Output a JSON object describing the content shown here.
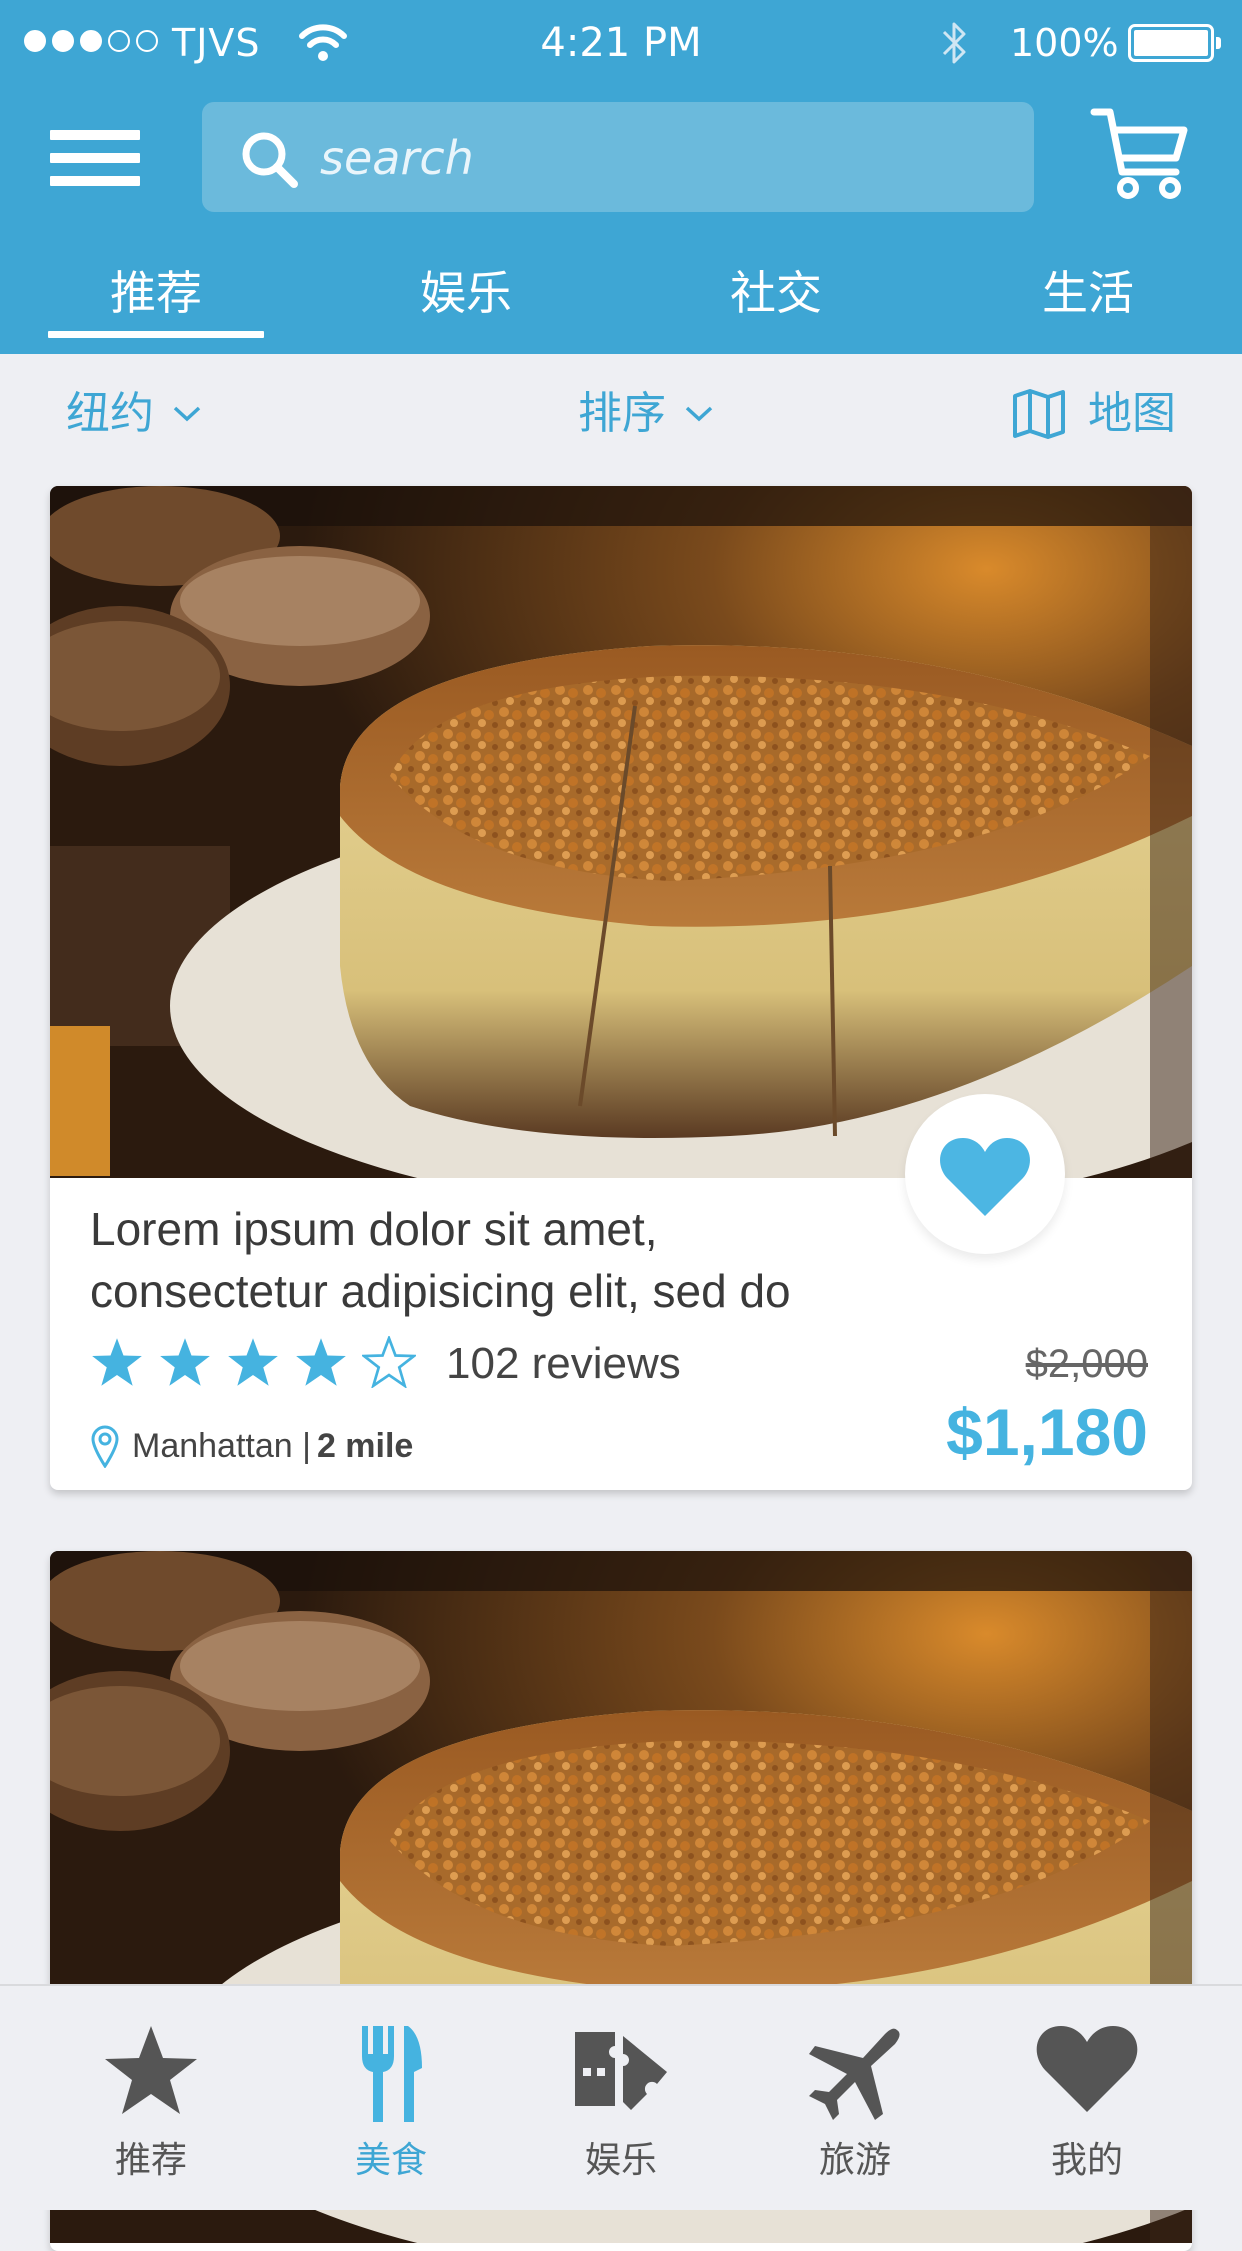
{
  "status_bar": {
    "carrier": "TJVS",
    "time": "4:21 PM",
    "battery": "100%",
    "signal_bars": 3
  },
  "header": {
    "search_placeholder": "search",
    "tabs": [
      {
        "label": "推荐",
        "active": true
      },
      {
        "label": "娱乐",
        "active": false
      },
      {
        "label": "社交",
        "active": false
      },
      {
        "label": "生活",
        "active": false
      }
    ]
  },
  "filters": {
    "location": "纽约",
    "sort": "排序",
    "map": "地图"
  },
  "cards": [
    {
      "title_line1": "Lorem ipsum dolor sit amet,",
      "title_line2": "consectetur adipisicing elit, sed do",
      "rating": 4,
      "rating_max": 5,
      "reviews": "102 reviews",
      "location": "Manhattan |",
      "distance": "2 mile",
      "old_price": "$2,000",
      "price": "$1,180",
      "favorited": true
    },
    {
      "partial": true
    }
  ],
  "bottom_nav": [
    {
      "label": "推荐",
      "icon": "star-icon",
      "active": false
    },
    {
      "label": "美食",
      "icon": "fork-knife-icon",
      "active": true
    },
    {
      "label": "娱乐",
      "icon": "ticket-icon",
      "active": false
    },
    {
      "label": "旅游",
      "icon": "airplane-icon",
      "active": false
    },
    {
      "label": "我的",
      "icon": "heart-icon",
      "active": false
    }
  ],
  "colors": {
    "primary": "#3ea6d4",
    "price": "#45b3e0",
    "background": "#eeeff3",
    "nav_inactive": "#555555"
  }
}
